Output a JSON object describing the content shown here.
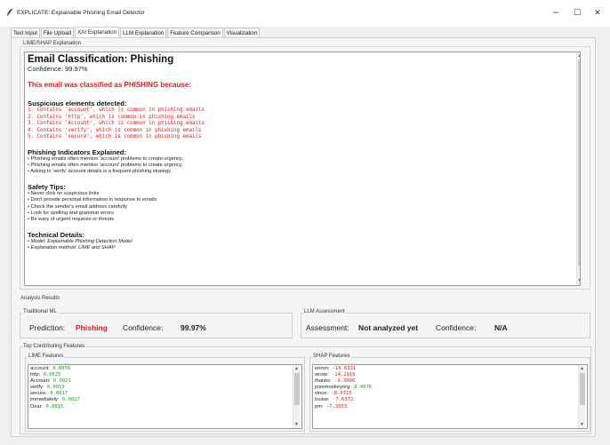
{
  "window": {
    "title": "EXPLICATE: Explainable Phishing Email Detector",
    "controls": {
      "minimize": "–",
      "maximize": "☐",
      "close": "✕"
    }
  },
  "tabs": [
    {
      "label": "Text Input",
      "active": false
    },
    {
      "label": "File Upload",
      "active": false
    },
    {
      "label": "XAI Explanation",
      "active": true
    },
    {
      "label": "LLM Explanation",
      "active": false
    },
    {
      "label": "Feature Comparison",
      "active": false
    },
    {
      "label": "Visualization",
      "active": false
    }
  ],
  "explanation": {
    "group_label": "LIME/SHAP Explanation",
    "heading": "Email Classification: Phishing",
    "confidence_line": "Confidence: 99.97%",
    "verdict": "This email was classified as PHISHING because:",
    "suspicious_title": "Suspicious elements detected:",
    "suspicious_items": [
      "1. Contains 'account', which is common in phishing emails",
      "2. Contains 'http', which is common in phishing emails",
      "3. Contains 'Account', which is common in phishing emails",
      "4. Contains 'verify', which is common in phishing emails",
      "5. Contains 'secure', which is common in phishing emails"
    ],
    "indicators_title": "Phishing Indicators Explained:",
    "indicators": [
      "• Phishing emails often mention 'account' problems to create urgency.",
      "• Phishing emails often mention 'account' problems to create urgency.",
      "• Asking to 'verify' account details is a frequent phishing strategy."
    ],
    "safety_title": "Safety Tips:",
    "safety_tips": [
      "• Never click on suspicious links",
      "• Don't provide personal information in response to emails",
      "• Check the sender's email address carefully",
      "• Look for spelling and grammar errors",
      "• Be wary of urgent requests or threats"
    ],
    "technical_title": "Technical Details:",
    "technical": [
      "• Model: Explainable Phishing Detection Model",
      "• Explanation method: LIME and SHAP"
    ]
  },
  "analysis": {
    "group_label": "Analysis Results",
    "traditional_ml": {
      "group_label": "Traditional ML",
      "prediction_label": "Prediction:",
      "prediction_value": "Phishing",
      "confidence_label": "Confidence:",
      "confidence_value": "99.97%"
    },
    "llm": {
      "group_label": "LLM Assessment",
      "assessment_label": "Assessment:",
      "assessment_value": "Not analyzed yet",
      "confidence_label": "Confidence:",
      "confidence_value": "N/A"
    }
  },
  "features": {
    "group_label": "Top Contributing Features",
    "lime": {
      "group_label": "LIME Features",
      "items": [
        {
          "name": "account:",
          "value": "0.0056"
        },
        {
          "name": "http:",
          "value": "0.0025"
        },
        {
          "name": "Account:",
          "value": "0.0021"
        },
        {
          "name": "verify:",
          "value": "0.0019"
        },
        {
          "name": "secure:",
          "value": "0.0017"
        },
        {
          "name": "immediately:",
          "value": "0.0017"
        },
        {
          "name": "Dear:",
          "value": "0.0015"
        }
      ]
    },
    "shap": {
      "group_label": "SHAP Features",
      "items": [
        {
          "name": "enron:",
          "value": "-16.6331",
          "sign": "neg"
        },
        {
          "name": "wrote:",
          "value": "-14.2916",
          "sign": "neg"
        },
        {
          "name": "thanks:",
          "value": "-9.3006",
          "sign": "neg"
        },
        {
          "name": "josemonkeyorg:",
          "value": "8.4076",
          "sign": "pos"
        },
        {
          "name": "vince:",
          "value": "-8.0715",
          "sign": "neg"
        },
        {
          "name": "louise:",
          "value": "-7.6372",
          "sign": "neg"
        },
        {
          "name": "pm:",
          "value": "-7.3053",
          "sign": "neg"
        }
      ]
    }
  },
  "colors": {
    "phishing_red": "#e0191b",
    "positive_green": "#1f9a1f"
  }
}
